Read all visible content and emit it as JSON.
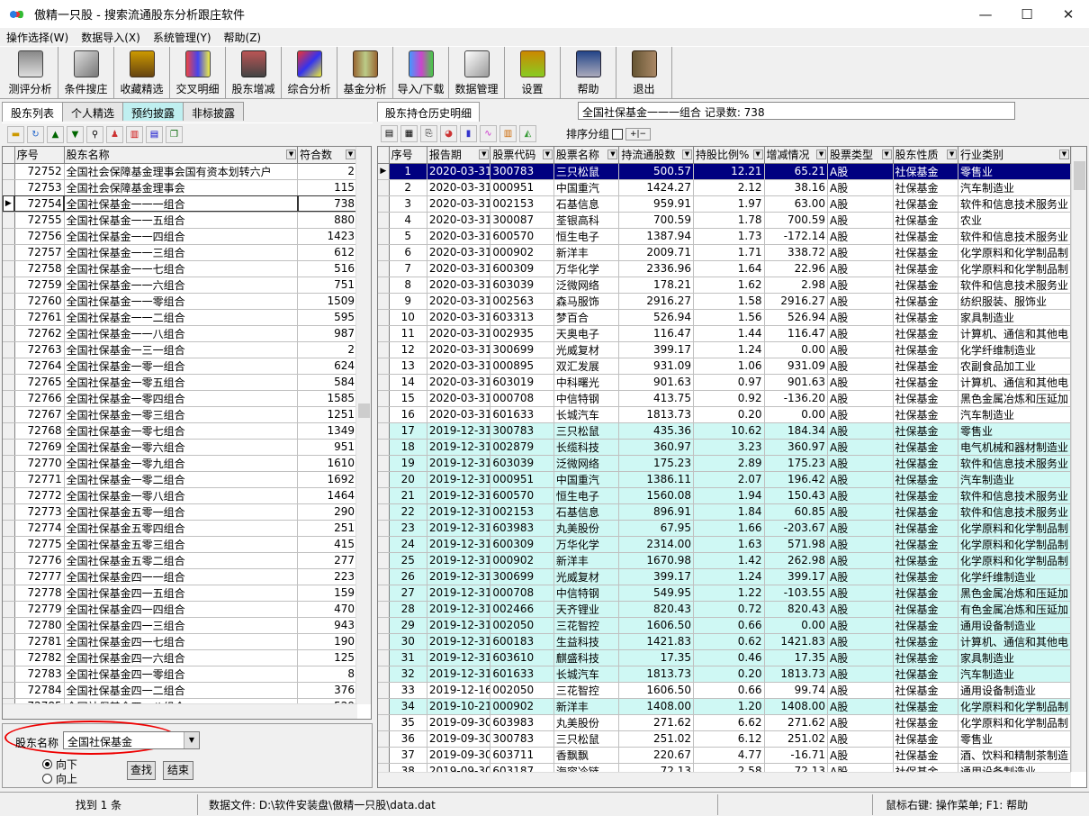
{
  "window": {
    "title": "傲精一只股 - 搜索流通股东分析跟庄软件",
    "min": "—",
    "max": "☐",
    "close": "✕"
  },
  "menu": [
    "操作选择(W)",
    "数据导入(X)",
    "系统管理(Y)",
    "帮助(Z)"
  ],
  "toolbar": [
    {
      "label": "测评分析",
      "icon": "evaluate-icon"
    },
    {
      "label": "条件搜庄",
      "icon": "magnifier-icon"
    },
    {
      "label": "收藏精选",
      "icon": "briefcase-icon"
    },
    {
      "label": "交叉明细",
      "icon": "people-icon"
    },
    {
      "label": "股东增减",
      "icon": "user-icon"
    },
    {
      "label": "综合分析",
      "icon": "cubes-icon"
    },
    {
      "label": "基金分析",
      "icon": "books-icon"
    },
    {
      "label": "导入/下载",
      "icon": "files-icon"
    },
    {
      "label": "数据管理",
      "icon": "document-icon"
    },
    {
      "label": "设置",
      "icon": "gift-icon"
    },
    {
      "label": "帮助",
      "icon": "help-book-icon"
    },
    {
      "label": "退出",
      "icon": "exit-door-icon"
    }
  ],
  "left": {
    "tabs": [
      "股东列表",
      "个人精选",
      "预约披露",
      "非标披露"
    ],
    "tool_icons": [
      "open-folder-icon",
      "refresh-icon",
      "arrow-up-icon",
      "arrow-down-icon",
      "binoculars-icon",
      "people-icon",
      "chart-icon",
      "chart-alt-icon",
      "copy-icon"
    ],
    "headers": [
      "序号",
      "股东名称",
      "符合数"
    ],
    "rows": [
      [
        "72752",
        "全国社会保障基金理事会国有资本划转六户",
        "2"
      ],
      [
        "72753",
        "全国社会保障基金理事会",
        "115"
      ],
      [
        "72754",
        "全国社保基金一一一组合",
        "738"
      ],
      [
        "72755",
        "全国社保基金一一五组合",
        "880"
      ],
      [
        "72756",
        "全国社保基金一一四组合",
        "1423"
      ],
      [
        "72757",
        "全国社保基金一一三组合",
        "612"
      ],
      [
        "72758",
        "全国社保基金一一七组合",
        "516"
      ],
      [
        "72759",
        "全国社保基金一一六组合",
        "751"
      ],
      [
        "72760",
        "全国社保基金一一零组合",
        "1509"
      ],
      [
        "72761",
        "全国社保基金一一二组合",
        "595"
      ],
      [
        "72762",
        "全国社保基金一一八组合",
        "987"
      ],
      [
        "72763",
        "全国社保基金一三一组合",
        "2"
      ],
      [
        "72764",
        "全国社保基金一零一组合",
        "624"
      ],
      [
        "72765",
        "全国社保基金一零五组合",
        "584"
      ],
      [
        "72766",
        "全国社保基金一零四组合",
        "1585"
      ],
      [
        "72767",
        "全国社保基金一零三组合",
        "1251"
      ],
      [
        "72768",
        "全国社保基金一零七组合",
        "1349"
      ],
      [
        "72769",
        "全国社保基金一零六组合",
        "951"
      ],
      [
        "72770",
        "全国社保基金一零九组合",
        "1610"
      ],
      [
        "72771",
        "全国社保基金一零二组合",
        "1692"
      ],
      [
        "72772",
        "全国社保基金一零八组合",
        "1464"
      ],
      [
        "72773",
        "全国社保基金五零一组合",
        "290"
      ],
      [
        "72774",
        "全国社保基金五零四组合",
        "251"
      ],
      [
        "72775",
        "全国社保基金五零三组合",
        "415"
      ],
      [
        "72776",
        "全国社保基金五零二组合",
        "277"
      ],
      [
        "72777",
        "全国社保基金四一一组合",
        "223"
      ],
      [
        "72778",
        "全国社保基金四一五组合",
        "159"
      ],
      [
        "72779",
        "全国社保基金四一四组合",
        "470"
      ],
      [
        "72780",
        "全国社保基金四一三组合",
        "943"
      ],
      [
        "72781",
        "全国社保基金四一七组合",
        "190"
      ],
      [
        "72782",
        "全国社保基金四一六组合",
        "125"
      ],
      [
        "72783",
        "全国社保基金四一零组合",
        "8"
      ],
      [
        "72784",
        "全国社保基金四一二组合",
        "376"
      ],
      [
        "72785",
        "全国社保基金四一八组合",
        "529"
      ],
      [
        "72786",
        "全国社保基金四零一组合",
        "215"
      ]
    ],
    "selected_index": 2,
    "search": {
      "label": "股东名称",
      "value": "全国社保基金",
      "down": "向下",
      "up": "向上",
      "find": "查找",
      "end": "结束"
    }
  },
  "right": {
    "tab": "股东持仓历史明细",
    "info": "全国社保基金一一一组合   记录数: 738",
    "sort_label": "排序分组",
    "tool_icons": [
      "table-icon",
      "grid-icon",
      "export-icon",
      "pie-icon",
      "bar-icon",
      "line-icon",
      "bar-color-icon",
      "area-chart-icon"
    ],
    "headers": [
      "序号",
      "报告期",
      "股票代码",
      "股票名称",
      "持流通股数",
      "持股比例%",
      "增减情况",
      "股票类型",
      "股东性质",
      "行业类别"
    ],
    "rows": [
      [
        "1",
        "2020-03-31",
        "300783",
        "三只松鼠",
        "500.57",
        "12.21",
        "65.21",
        "A股",
        "社保基金",
        "零售业"
      ],
      [
        "2",
        "2020-03-31",
        "000951",
        "中国重汽",
        "1424.27",
        "2.12",
        "38.16",
        "A股",
        "社保基金",
        "汽车制造业"
      ],
      [
        "3",
        "2020-03-31",
        "002153",
        "石基信息",
        "959.91",
        "1.97",
        "63.00",
        "A股",
        "社保基金",
        "软件和信息技术服务业"
      ],
      [
        "4",
        "2020-03-31",
        "300087",
        "荃银高科",
        "700.59",
        "1.78",
        "700.59",
        "A股",
        "社保基金",
        "农业"
      ],
      [
        "5",
        "2020-03-31",
        "600570",
        "恒生电子",
        "1387.94",
        "1.73",
        "-172.14",
        "A股",
        "社保基金",
        "软件和信息技术服务业"
      ],
      [
        "6",
        "2020-03-31",
        "000902",
        "新洋丰",
        "2009.71",
        "1.71",
        "338.72",
        "A股",
        "社保基金",
        "化学原料和化学制品制"
      ],
      [
        "7",
        "2020-03-31",
        "600309",
        "万华化学",
        "2336.96",
        "1.64",
        "22.96",
        "A股",
        "社保基金",
        "化学原料和化学制品制"
      ],
      [
        "8",
        "2020-03-31",
        "603039",
        "泛微网络",
        "178.21",
        "1.62",
        "2.98",
        "A股",
        "社保基金",
        "软件和信息技术服务业"
      ],
      [
        "9",
        "2020-03-31",
        "002563",
        "森马服饰",
        "2916.27",
        "1.58",
        "2916.27",
        "A股",
        "社保基金",
        "纺织服装、服饰业"
      ],
      [
        "10",
        "2020-03-31",
        "603313",
        "梦百合",
        "526.94",
        "1.56",
        "526.94",
        "A股",
        "社保基金",
        "家具制造业"
      ],
      [
        "11",
        "2020-03-31",
        "002935",
        "天奥电子",
        "116.47",
        "1.44",
        "116.47",
        "A股",
        "社保基金",
        "计算机、通信和其他电"
      ],
      [
        "12",
        "2020-03-31",
        "300699",
        "光威复材",
        "399.17",
        "1.24",
        "0.00",
        "A股",
        "社保基金",
        "化学纤维制造业"
      ],
      [
        "13",
        "2020-03-31",
        "000895",
        "双汇发展",
        "931.09",
        "1.06",
        "931.09",
        "A股",
        "社保基金",
        "农副食品加工业"
      ],
      [
        "14",
        "2020-03-31",
        "603019",
        "中科曙光",
        "901.63",
        "0.97",
        "901.63",
        "A股",
        "社保基金",
        "计算机、通信和其他电"
      ],
      [
        "15",
        "2020-03-31",
        "000708",
        "中信特钢",
        "413.75",
        "0.92",
        "-136.20",
        "A股",
        "社保基金",
        "黑色金属冶炼和压延加"
      ],
      [
        "16",
        "2020-03-31",
        "601633",
        "长城汽车",
        "1813.73",
        "0.20",
        "0.00",
        "A股",
        "社保基金",
        "汽车制造业"
      ],
      [
        "17",
        "2019-12-31",
        "300783",
        "三只松鼠",
        "435.36",
        "10.62",
        "184.34",
        "A股",
        "社保基金",
        "零售业"
      ],
      [
        "18",
        "2019-12-31",
        "002879",
        "长缆科技",
        "360.97",
        "3.23",
        "360.97",
        "A股",
        "社保基金",
        "电气机械和器材制造业"
      ],
      [
        "19",
        "2019-12-31",
        "603039",
        "泛微网络",
        "175.23",
        "2.89",
        "175.23",
        "A股",
        "社保基金",
        "软件和信息技术服务业"
      ],
      [
        "20",
        "2019-12-31",
        "000951",
        "中国重汽",
        "1386.11",
        "2.07",
        "196.42",
        "A股",
        "社保基金",
        "汽车制造业"
      ],
      [
        "21",
        "2019-12-31",
        "600570",
        "恒生电子",
        "1560.08",
        "1.94",
        "150.43",
        "A股",
        "社保基金",
        "软件和信息技术服务业"
      ],
      [
        "22",
        "2019-12-31",
        "002153",
        "石基信息",
        "896.91",
        "1.84",
        "60.85",
        "A股",
        "社保基金",
        "软件和信息技术服务业"
      ],
      [
        "23",
        "2019-12-31",
        "603983",
        "丸美股份",
        "67.95",
        "1.66",
        "-203.67",
        "A股",
        "社保基金",
        "化学原料和化学制品制"
      ],
      [
        "24",
        "2019-12-31",
        "600309",
        "万华化学",
        "2314.00",
        "1.63",
        "571.98",
        "A股",
        "社保基金",
        "化学原料和化学制品制"
      ],
      [
        "25",
        "2019-12-31",
        "000902",
        "新洋丰",
        "1670.98",
        "1.42",
        "262.98",
        "A股",
        "社保基金",
        "化学原料和化学制品制"
      ],
      [
        "26",
        "2019-12-31",
        "300699",
        "光威复材",
        "399.17",
        "1.24",
        "399.17",
        "A股",
        "社保基金",
        "化学纤维制造业"
      ],
      [
        "27",
        "2019-12-31",
        "000708",
        "中信特钢",
        "549.95",
        "1.22",
        "-103.55",
        "A股",
        "社保基金",
        "黑色金属冶炼和压延加"
      ],
      [
        "28",
        "2019-12-31",
        "002466",
        "天齐锂业",
        "820.43",
        "0.72",
        "820.43",
        "A股",
        "社保基金",
        "有色金属冶炼和压延加"
      ],
      [
        "29",
        "2019-12-31",
        "002050",
        "三花智控",
        "1606.50",
        "0.66",
        "0.00",
        "A股",
        "社保基金",
        "通用设备制造业"
      ],
      [
        "30",
        "2019-12-31",
        "600183",
        "生益科技",
        "1421.83",
        "0.62",
        "1421.83",
        "A股",
        "社保基金",
        "计算机、通信和其他电"
      ],
      [
        "31",
        "2019-12-31",
        "603610",
        "麒盛科技",
        "17.35",
        "0.46",
        "17.35",
        "A股",
        "社保基金",
        "家具制造业"
      ],
      [
        "32",
        "2019-12-31",
        "601633",
        "长城汽车",
        "1813.73",
        "0.20",
        "1813.73",
        "A股",
        "社保基金",
        "汽车制造业"
      ],
      [
        "33",
        "2019-12-16",
        "002050",
        "三花智控",
        "1606.50",
        "0.66",
        "99.74",
        "A股",
        "社保基金",
        "通用设备制造业"
      ],
      [
        "34",
        "2019-10-21",
        "000902",
        "新洋丰",
        "1408.00",
        "1.20",
        "1408.00",
        "A股",
        "社保基金",
        "化学原料和化学制品制"
      ],
      [
        "35",
        "2019-09-30",
        "603983",
        "丸美股份",
        "271.62",
        "6.62",
        "271.62",
        "A股",
        "社保基金",
        "化学原料和化学制品制"
      ],
      [
        "36",
        "2019-09-30",
        "300783",
        "三只松鼠",
        "251.02",
        "6.12",
        "251.02",
        "A股",
        "社保基金",
        "零售业"
      ],
      [
        "37",
        "2019-09-30",
        "603711",
        "香飘飘",
        "220.67",
        "4.77",
        "-16.71",
        "A股",
        "社保基金",
        "酒、饮料和精制茶制造"
      ],
      [
        "38",
        "2019-09-30",
        "603187",
        "海容冷链",
        "72.13",
        "2.58",
        "72.13",
        "A股",
        "社保基金",
        "通用设备制造业"
      ]
    ],
    "cyan_rows": [
      17,
      18,
      19,
      20,
      21,
      22,
      23,
      24,
      25,
      26,
      27,
      28,
      29,
      30,
      31,
      32,
      34
    ]
  },
  "status": {
    "found": "找到 1 条",
    "datafile": "数据文件: D:\\软件安装盘\\傲精一只股\\data.dat",
    "hint": "鼠标右键: 操作菜单;   F1: 帮助"
  }
}
